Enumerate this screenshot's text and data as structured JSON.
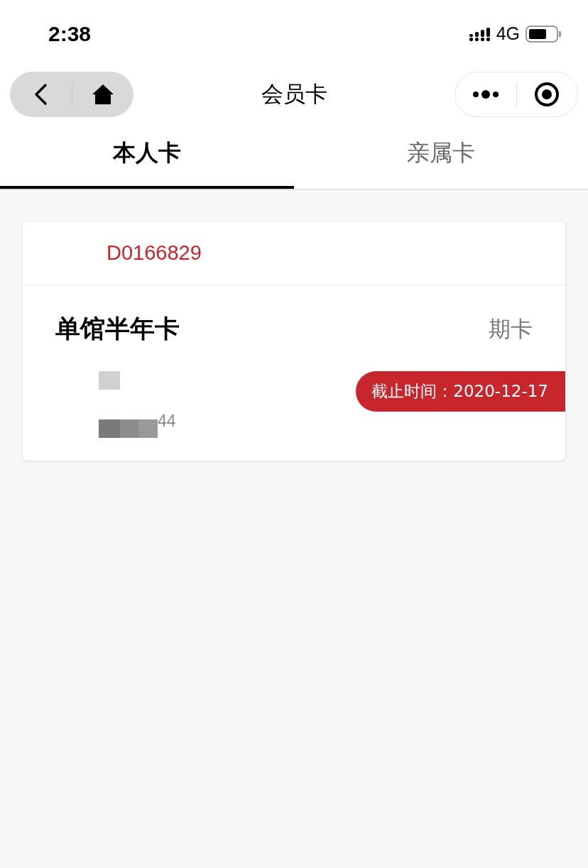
{
  "status_bar": {
    "time": "2:38",
    "network": "4G"
  },
  "nav_bar": {
    "title": "会员卡"
  },
  "tabs": [
    {
      "label": "本人卡",
      "selected": true
    },
    {
      "label": "亲属卡",
      "selected": false
    }
  ],
  "card": {
    "number": "D0166829",
    "name": "单馆半年卡",
    "type": "期卡",
    "partial_text": "44",
    "expiry": "截止时间：2020-12-17"
  }
}
